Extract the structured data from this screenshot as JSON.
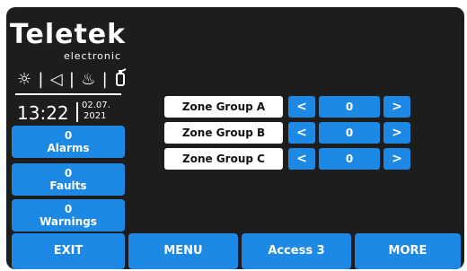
{
  "brand": {
    "name": "Teletek",
    "sub": "electronic"
  },
  "status_icons": [
    {
      "icon": "sun-icon",
      "glyph": "☼"
    },
    {
      "icon": "speaker-icon",
      "glyph": "◁"
    },
    {
      "icon": "fire-icon",
      "glyph": "♨"
    },
    {
      "icon": "extinguisher-icon",
      "glyph": "⛽"
    }
  ],
  "clock": {
    "time": "13:22",
    "date_line1": "02.07.",
    "date_line2": "2021"
  },
  "side_panel": {
    "alarms": {
      "count": "0",
      "label": "Alarms"
    },
    "faults": {
      "count": "0",
      "label": "Faults"
    },
    "warnings": {
      "count": "0",
      "label": "Warnings"
    }
  },
  "zone_groups": [
    {
      "label": "Zone Group A",
      "value": "0",
      "prev": "<",
      "next": ">"
    },
    {
      "label": "Zone Group B",
      "value": "0",
      "prev": "<",
      "next": ">"
    },
    {
      "label": "Zone Group C",
      "value": "0",
      "prev": "<",
      "next": ">"
    }
  ],
  "bottom_bar": {
    "exit": "EXIT",
    "menu": "MENU",
    "access": "Access 3",
    "more": "MORE"
  },
  "colors": {
    "accent": "#1e88e5",
    "background": "#1d1d1d",
    "text": "#ffffff"
  }
}
